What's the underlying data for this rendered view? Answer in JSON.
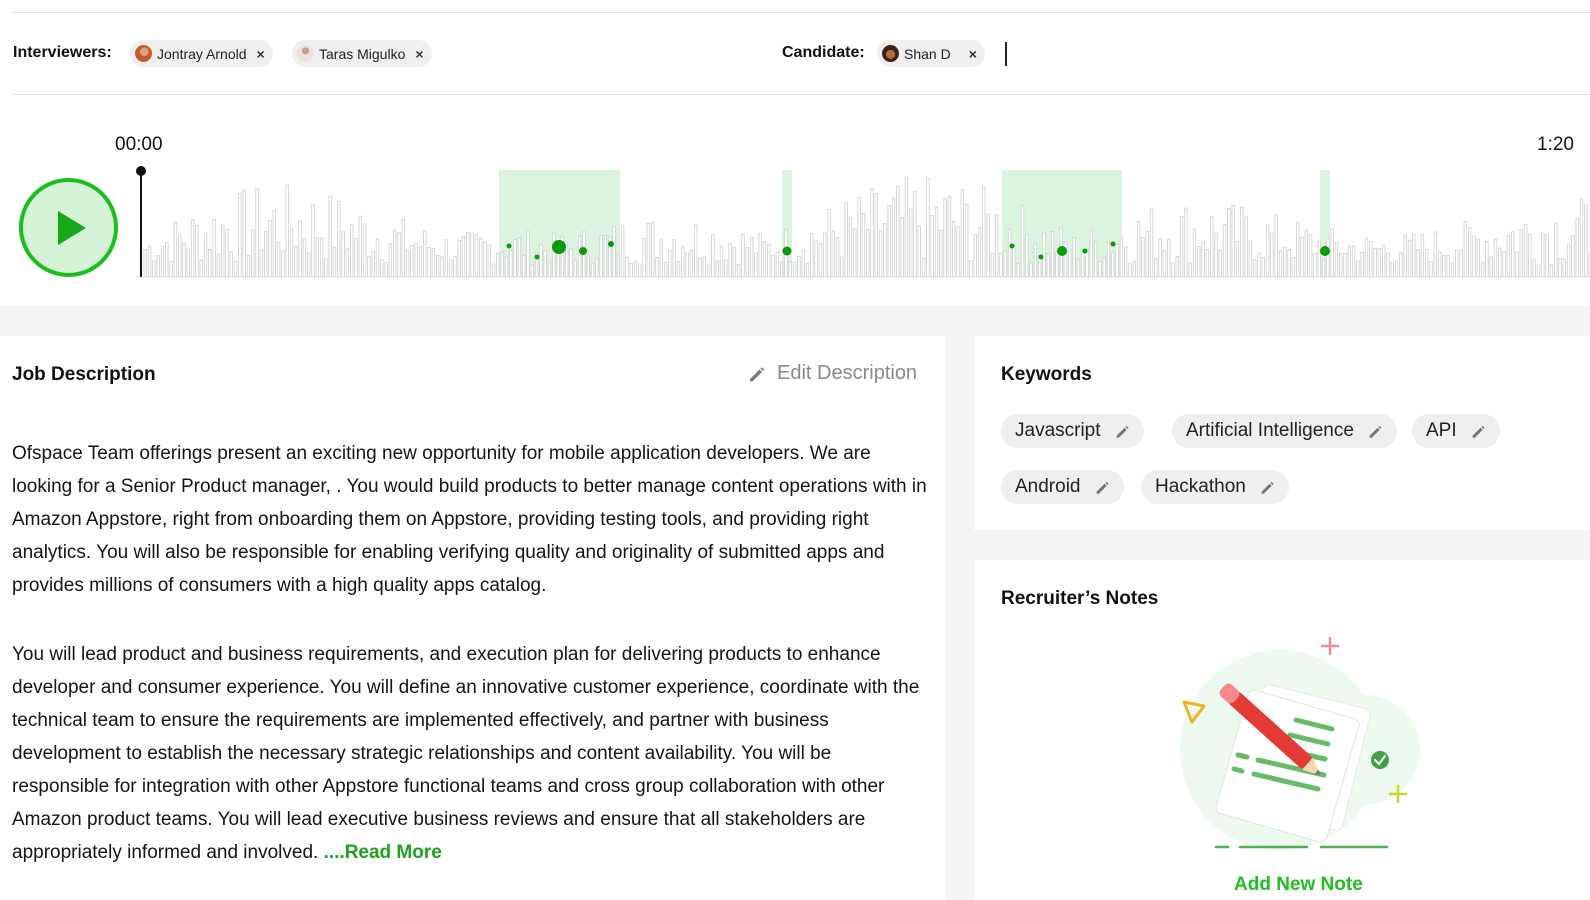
{
  "header": {
    "interviewers_label": "Interviewers:",
    "interviewers": [
      {
        "name": "Jontray Arnold"
      },
      {
        "name": "Taras Migulko"
      }
    ],
    "candidate_label": "Candidate:",
    "candidate": {
      "name": "Shan D"
    },
    "remove_symbol": "×"
  },
  "player": {
    "start_time": "00:00",
    "end_time": "1:20",
    "accent": "#1bbf1b",
    "highlight": "#dcf3e0",
    "marker": "#0c9a0c"
  },
  "job_description": {
    "title": "Job Description",
    "edit_label": "Edit Description",
    "paragraph1": "Ofspace Team offerings present an exciting new opportunity for mobile application developers. We are looking for a Senior Product manager, . You would build products to better manage content operations with in Amazon Appstore, right from onboarding them on Appstore, providing testing tools, and providing right analytics. You will also be responsible for enabling verifying quality and originality of submitted apps and provides millions of consumers with a high quality apps catalog.",
    "paragraph2": "You will lead product and business requirements, and execution plan for delivering products to enhance developer and consumer experience. You will define an innovative customer experience, coordinate with the technical team to ensure the requirements are implemented effectively, and partner with business development to establish the necessary strategic relationships and content availability. You will be responsible for integration with other Appstore functional teams and cross group collaboration with other Amazon product teams. You will lead executive business reviews and ensure that all stakeholders are appropriately informed and involved.",
    "read_more": "....Read More"
  },
  "keywords": {
    "title": "Keywords",
    "items": [
      "Javascript",
      "Artificial Intelligence",
      "API",
      "Android",
      "Hackathon"
    ]
  },
  "notes": {
    "title": "Recruiter’s Notes",
    "add_label": "Add New Note"
  },
  "icons": {
    "remove": "close-icon",
    "edit": "pencil-icon",
    "play": "play-icon",
    "notes_illustration": "note-illustration"
  }
}
